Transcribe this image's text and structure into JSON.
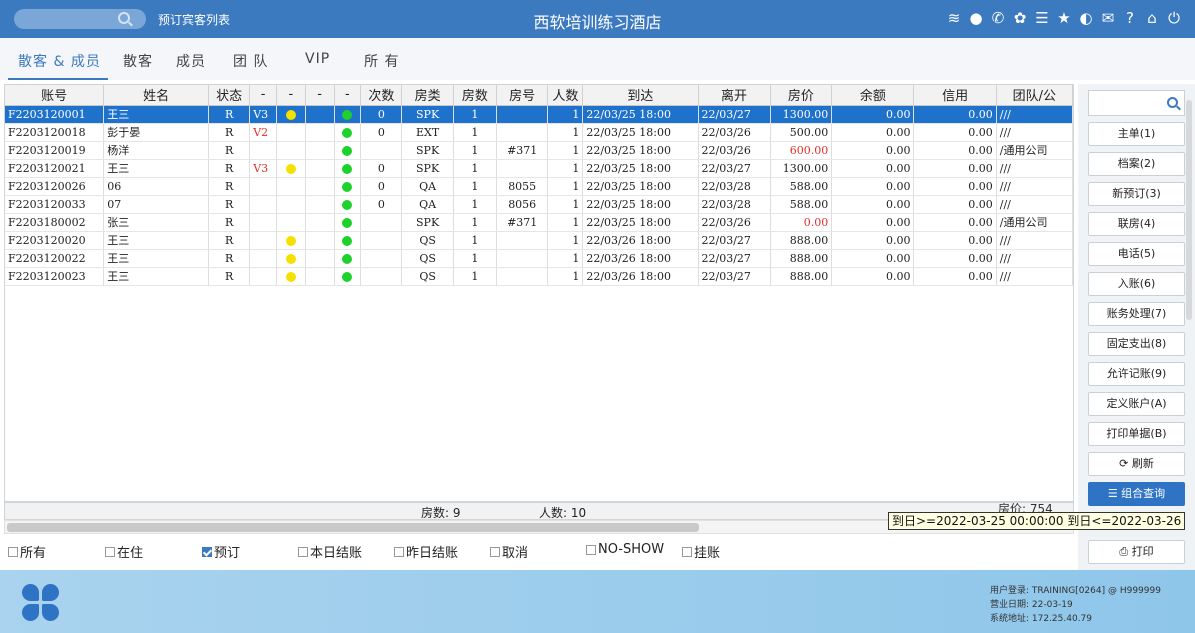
{
  "top": {
    "search_link": "预订宾客列表",
    "title": "西软培训练习酒店",
    "icons": [
      "wifi-icon",
      "chat-icon",
      "phone-icon",
      "palette-icon",
      "menu-icon",
      "star-icon",
      "moon-icon",
      "mail-icon",
      "help-icon",
      "home-icon",
      "power-icon"
    ]
  },
  "tabs": [
    {
      "label": "散客 & 成员",
      "active": true
    },
    {
      "label": "散客"
    },
    {
      "label": "成员"
    },
    {
      "label": "团 队"
    },
    {
      "label": "VIP"
    },
    {
      "label": "所 有"
    }
  ],
  "table": {
    "headers": [
      "账号",
      "姓名",
      "状态",
      "-",
      "-",
      "-",
      "-",
      "次数",
      "房类",
      "房数",
      "房号",
      "人数",
      "到达",
      "离开",
      "房价",
      "余额",
      "信用",
      "团队/公"
    ],
    "rows": [
      {
        "acct": "F2203120001",
        "name": "王三",
        "status": "R",
        "v": "V3",
        "yellow": true,
        "green": true,
        "times": "0",
        "rtype": "SPK",
        "rooms": "1",
        "roomno": "",
        "people": "1",
        "arrive": "22/03/25 18:00",
        "leave": "22/03/27",
        "price": "1300.00",
        "balance": "0.00",
        "credit": "0.00",
        "group": "///",
        "selected": true
      },
      {
        "acct": "F2203120018",
        "name": "彭于晏",
        "status": "R",
        "v": "V2",
        "yellow": false,
        "green": true,
        "times": "0",
        "rtype": "EXT",
        "rooms": "1",
        "roomno": "",
        "people": "1",
        "arrive": "22/03/25 18:00",
        "leave": "22/03/26",
        "price": "500.00",
        "balance": "0.00",
        "credit": "0.00",
        "group": "///"
      },
      {
        "acct": "F2203120019",
        "name": "杨洋",
        "status": "R",
        "v": "",
        "yellow": false,
        "green": true,
        "times": "",
        "rtype": "SPK",
        "rooms": "1",
        "roomno": "#371",
        "people": "1",
        "arrive": "22/03/25 18:00",
        "leave": "22/03/26",
        "price": "600.00",
        "price_red": true,
        "balance": "0.00",
        "credit": "0.00",
        "group": "/通用公司"
      },
      {
        "acct": "F2203120021",
        "name": "王三",
        "status": "R",
        "v": "V3",
        "yellow": true,
        "green": true,
        "times": "0",
        "rtype": "SPK",
        "rooms": "1",
        "roomno": "",
        "people": "1",
        "arrive": "22/03/25 18:00",
        "leave": "22/03/27",
        "price": "1300.00",
        "balance": "0.00",
        "credit": "0.00",
        "group": "///"
      },
      {
        "acct": "F2203120026",
        "name": "06",
        "status": "R",
        "v": "",
        "yellow": false,
        "green": true,
        "times": "0",
        "rtype": "QA",
        "rooms": "1",
        "roomno": "8055",
        "people": "1",
        "arrive": "22/03/25 18:00",
        "leave": "22/03/28",
        "price": "588.00",
        "balance": "0.00",
        "credit": "0.00",
        "group": "///"
      },
      {
        "acct": "F2203120033",
        "name": "07",
        "status": "R",
        "v": "",
        "yellow": false,
        "green": true,
        "times": "0",
        "rtype": "QA",
        "rooms": "1",
        "roomno": "8056",
        "people": "1",
        "arrive": "22/03/25 18:00",
        "leave": "22/03/28",
        "price": "588.00",
        "balance": "0.00",
        "credit": "0.00",
        "group": "///"
      },
      {
        "acct": "F2203180002",
        "name": "张三",
        "status": "R",
        "v": "",
        "yellow": false,
        "green": true,
        "times": "",
        "rtype": "SPK",
        "rooms": "1",
        "roomno": "#371",
        "people": "1",
        "arrive": "22/03/25 18:00",
        "leave": "22/03/26",
        "price": "0.00",
        "price_red": true,
        "balance": "0.00",
        "credit": "0.00",
        "group": "/通用公司"
      },
      {
        "acct": "F2203120020",
        "name": "王三",
        "status": "R",
        "v": "",
        "yellow": true,
        "green": true,
        "times": "",
        "rtype": "QS",
        "rooms": "1",
        "roomno": "",
        "people": "1",
        "arrive": "22/03/26 18:00",
        "leave": "22/03/27",
        "price": "888.00",
        "balance": "0.00",
        "credit": "0.00",
        "group": "///"
      },
      {
        "acct": "F2203120022",
        "name": "王三",
        "status": "R",
        "v": "",
        "yellow": true,
        "green": true,
        "times": "",
        "rtype": "QS",
        "rooms": "1",
        "roomno": "",
        "people": "1",
        "arrive": "22/03/26 18:00",
        "leave": "22/03/27",
        "price": "888.00",
        "balance": "0.00",
        "credit": "0.00",
        "group": "///"
      },
      {
        "acct": "F2203120023",
        "name": "王三",
        "status": "R",
        "v": "",
        "yellow": true,
        "green": true,
        "times": "",
        "rtype": "QS",
        "rooms": "1",
        "roomno": "",
        "people": "1",
        "arrive": "22/03/26 18:00",
        "leave": "22/03/27",
        "price": "888.00",
        "balance": "0.00",
        "credit": "0.00",
        "group": "///"
      }
    ]
  },
  "summary": {
    "rooms": "房数: 9",
    "people": "人数: 10",
    "price": "房价: 754"
  },
  "tooltip": "到日>=2022-03-25 00:00:00 到日<=2022-03-26",
  "filters": [
    {
      "label": "所有",
      "checked": false
    },
    {
      "label": "在住",
      "checked": false
    },
    {
      "label": "预订",
      "checked": true
    },
    {
      "label": "本日结账",
      "checked": false
    },
    {
      "label": "昨日结账",
      "checked": false
    },
    {
      "label": "取消",
      "checked": false
    },
    {
      "label": "NO-SHOW",
      "checked": false
    },
    {
      "label": "挂账",
      "checked": false
    }
  ],
  "side": {
    "buttons": [
      "主单(1)",
      "档案(2)",
      "新预订(3)",
      "联房(4)",
      "电话(5)",
      "入账(6)",
      "账务处理(7)",
      "固定支出(8)",
      "允许记账(9)",
      "定义账户(A)",
      "打印单据(B)"
    ],
    "refresh": "刷新",
    "combo": "组合查询",
    "print": "打印"
  },
  "bottom": {
    "user": "用户登录: TRAINING[0264] @ H999999",
    "date": "营业日期: 22-03-19",
    "addr": "系统地址: 172.25.40.79"
  }
}
